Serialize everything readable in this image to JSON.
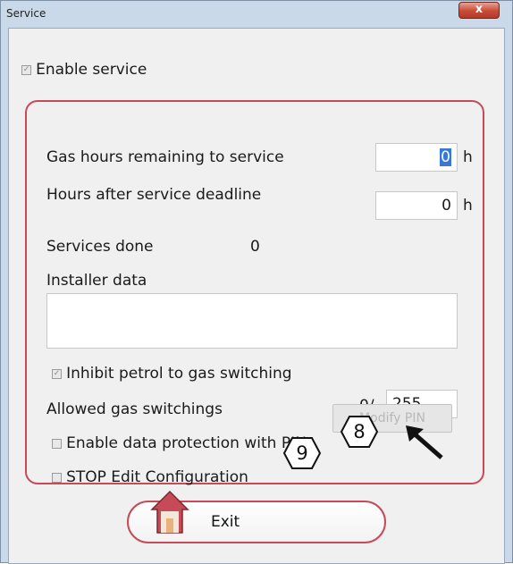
{
  "window": {
    "title": "Service",
    "close_glyph": "x"
  },
  "enable_service": {
    "label": "Enable service",
    "checked": true
  },
  "fields": {
    "gas_hours_label": "Gas hours remaining to service",
    "gas_hours_value": "0",
    "gas_hours_unit": "h",
    "hours_after_label": "Hours after service deadline",
    "hours_after_value": "0",
    "hours_after_unit": "h",
    "services_done_label": "Services done",
    "services_done_value": "0",
    "installer_label": "Installer data",
    "installer_value": ""
  },
  "inhibit": {
    "label": "Inhibit petrol to gas switching",
    "checked": true
  },
  "allowed": {
    "label": "Allowed gas switchings",
    "current": "0/",
    "max": "255"
  },
  "protection": {
    "label": "Enable data protection with PIN",
    "checked": false
  },
  "modify_pin": {
    "label": "Modify PIN"
  },
  "stop_edit": {
    "label": "STOP Edit Configuration",
    "checked": false
  },
  "annotations": {
    "badge_9": "9",
    "badge_8": "8"
  },
  "exit": {
    "label": "Exit"
  },
  "colors": {
    "accent": "#c64a58",
    "window_bg": "#f0f0f0",
    "frame": "#c9d9ea",
    "selection": "#3a78d8"
  }
}
